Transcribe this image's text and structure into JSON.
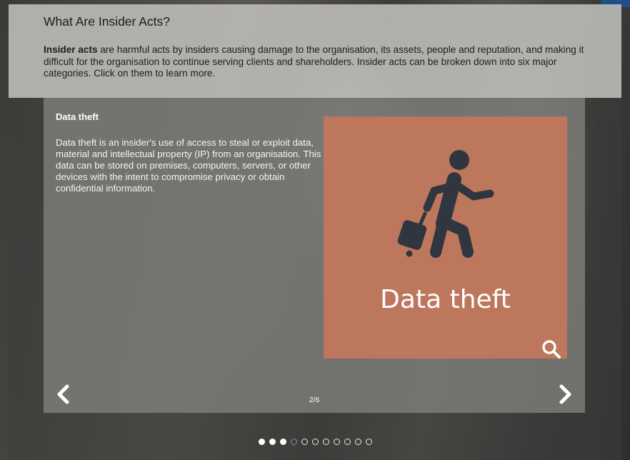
{
  "header": {
    "title": "What Are Insider Acts?",
    "intro_bold": "Insider acts",
    "intro_rest": " are harmful acts by insiders causing damage to the organisation, its assets, people and reputation, and making it difficult for the organisation to continue serving clients and shareholders. Insider acts can be broken down into six major categories. Click on them to learn more."
  },
  "slide": {
    "title": "Data theft",
    "body": "Data theft is an insider's use of access to steal or exploit data, material and intellectual property (IP) from an organisation. This data can be stored on premises, computers, servers, or other devices with the intent to compromise privacy or obtain confidential information.",
    "card_caption": "Data theft",
    "card_color": "#bd775d",
    "card_icon": "person-with-luggage-icon",
    "counter": "2/6"
  },
  "pagination": {
    "dots": [
      "filled",
      "filled",
      "filled",
      "current",
      "hollow",
      "hollow",
      "hollow",
      "hollow",
      "hollow",
      "hollow",
      "hollow"
    ]
  },
  "icons": {
    "prev": "chevron-left-icon",
    "next": "chevron-right-icon",
    "zoom": "search-icon"
  }
}
